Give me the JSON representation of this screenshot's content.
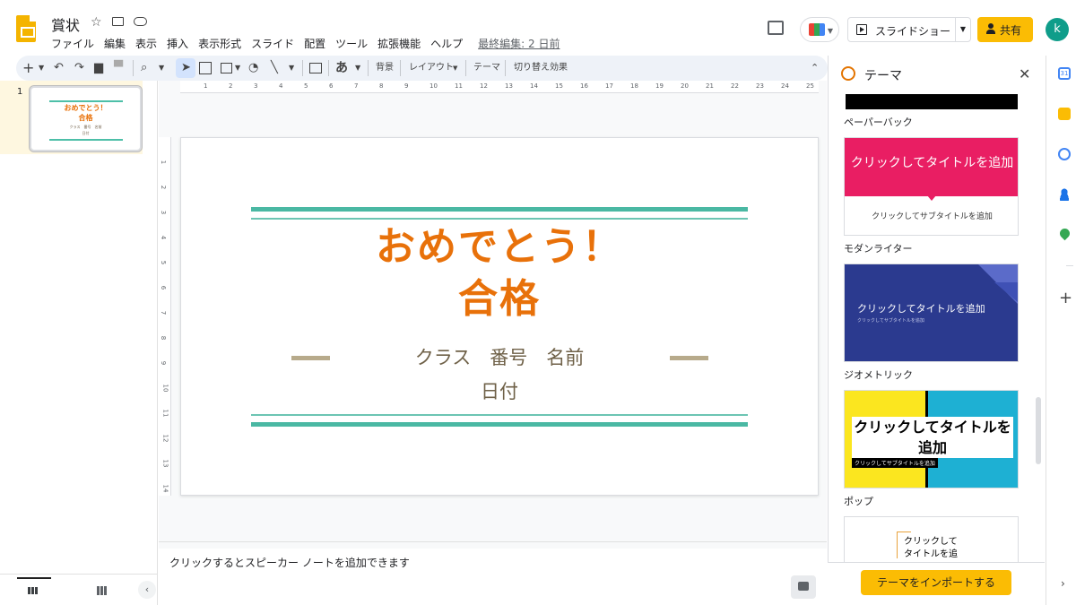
{
  "header": {
    "title": "賞状",
    "menu": [
      "ファイル",
      "編集",
      "表示",
      "挿入",
      "表示形式",
      "スライド",
      "配置",
      "ツール",
      "拡張機能",
      "ヘルプ"
    ],
    "last_edit": "最終編集: 2 日前",
    "slideshow_label": "スライドショー",
    "share_label": "共有",
    "avatar_letter": "k"
  },
  "toolbar": {
    "background_label": "背景",
    "layout_label": "レイアウト",
    "theme_label": "テーマ",
    "transition_label": "切り替え効果",
    "text_input_label": "あ"
  },
  "filmstrip": {
    "slide_number": "1",
    "thumb_title_line1": "おめでとう！",
    "thumb_title_line2": "合格",
    "thumb_sub_line1": "クラス　番号　名前",
    "thumb_sub_line2": "日付"
  },
  "slide": {
    "title_line1": "おめでとう！",
    "title_line2": "合格",
    "subtitle_line1": "クラス　番号　名前",
    "subtitle_line2": "日付",
    "accent_color": "#e8710a",
    "rule_color": "#4ab8a3",
    "text_color": "#6f6148"
  },
  "ruler": {
    "horizontal": [
      "1",
      "2",
      "3",
      "4",
      "5",
      "6",
      "7",
      "8",
      "9",
      "10",
      "11",
      "12",
      "13",
      "14",
      "15",
      "16",
      "17",
      "18",
      "19",
      "20",
      "21",
      "22",
      "23",
      "24",
      "25"
    ],
    "vertical": [
      "1",
      "2",
      "3",
      "4",
      "5",
      "6",
      "7",
      "8",
      "9",
      "10",
      "11",
      "12",
      "13",
      "14"
    ]
  },
  "notes": {
    "placeholder": "クリックするとスピーカー ノートを追加できます"
  },
  "theme_panel": {
    "title": "テーマ",
    "themes": [
      {
        "name": "ペーパーバック"
      },
      {
        "name": "モダンライター",
        "title": "クリックしてタイトルを追加",
        "subtitle": "クリックしてサブタイトルを追加",
        "color": "#e91e63"
      },
      {
        "name": "ジオメトリック",
        "title": "クリックしてタイトルを追加",
        "subtitle": "クリックしてサブタイトルを追加",
        "color": "#2b3a8f"
      },
      {
        "name": "ポップ",
        "title": "クリックしてタイトルを追加",
        "subtitle": "クリックしてサブタイトルを追加",
        "color": "#fbe61f"
      },
      {
        "title": "クリックして タイトルを追"
      }
    ],
    "import_label": "テーマをインポートする"
  },
  "rail": {
    "calendar_day": "31"
  }
}
